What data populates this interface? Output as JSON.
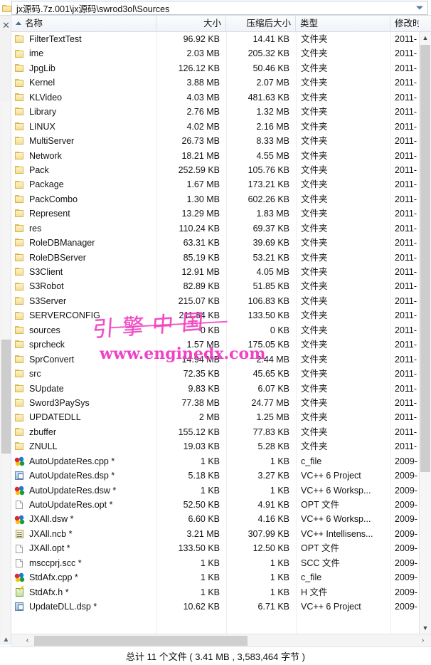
{
  "address": {
    "path": "jx源码.7z.001\\jx源码\\swrod3ol\\Sources",
    "dropdown_icon": "chevron-down-icon",
    "folder_icon": "folder-icon"
  },
  "left_rail": {
    "close_label": "✕",
    "up_label": "▲"
  },
  "columns": [
    {
      "key": "name",
      "label": "名称",
      "sorted": true
    },
    {
      "key": "size",
      "label": "大小",
      "sorted": false
    },
    {
      "key": "psize",
      "label": "压缩后大小",
      "sorted": false
    },
    {
      "key": "type",
      "label": "类型",
      "sorted": false
    },
    {
      "key": "mod",
      "label": "修改时",
      "sorted": false
    }
  ],
  "rows": [
    {
      "icon": "folder",
      "name": "FilterTextTest",
      "size": "96.92 KB",
      "psize": "14.41 KB",
      "type": "文件夹",
      "mod": "2011-"
    },
    {
      "icon": "folder",
      "name": "ime",
      "size": "2.03 MB",
      "psize": "205.32 KB",
      "type": "文件夹",
      "mod": "2011-"
    },
    {
      "icon": "folder",
      "name": "JpgLib",
      "size": "126.12 KB",
      "psize": "50.46 KB",
      "type": "文件夹",
      "mod": "2011-"
    },
    {
      "icon": "folder",
      "name": "Kernel",
      "size": "3.88 MB",
      "psize": "2.07 MB",
      "type": "文件夹",
      "mod": "2011-"
    },
    {
      "icon": "folder",
      "name": "KLVideo",
      "size": "4.03 MB",
      "psize": "481.63 KB",
      "type": "文件夹",
      "mod": "2011-"
    },
    {
      "icon": "folder",
      "name": "Library",
      "size": "2.76 MB",
      "psize": "1.32 MB",
      "type": "文件夹",
      "mod": "2011-"
    },
    {
      "icon": "folder",
      "name": "LINUX",
      "size": "4.02 MB",
      "psize": "2.16 MB",
      "type": "文件夹",
      "mod": "2011-"
    },
    {
      "icon": "folder",
      "name": "MultiServer",
      "size": "26.73 MB",
      "psize": "8.33 MB",
      "type": "文件夹",
      "mod": "2011-"
    },
    {
      "icon": "folder",
      "name": "Network",
      "size": "18.21 MB",
      "psize": "4.55 MB",
      "type": "文件夹",
      "mod": "2011-"
    },
    {
      "icon": "folder",
      "name": "Pack",
      "size": "252.59 KB",
      "psize": "105.76 KB",
      "type": "文件夹",
      "mod": "2011-"
    },
    {
      "icon": "folder",
      "name": "Package",
      "size": "1.67 MB",
      "psize": "173.21 KB",
      "type": "文件夹",
      "mod": "2011-"
    },
    {
      "icon": "folder",
      "name": "PackCombo",
      "size": "1.30 MB",
      "psize": "602.26 KB",
      "type": "文件夹",
      "mod": "2011-"
    },
    {
      "icon": "folder",
      "name": "Represent",
      "size": "13.29 MB",
      "psize": "1.83 MB",
      "type": "文件夹",
      "mod": "2011-"
    },
    {
      "icon": "folder",
      "name": "res",
      "size": "110.24 KB",
      "psize": "69.37 KB",
      "type": "文件夹",
      "mod": "2011-"
    },
    {
      "icon": "folder",
      "name": "RoleDBManager",
      "size": "63.31 KB",
      "psize": "39.69 KB",
      "type": "文件夹",
      "mod": "2011-"
    },
    {
      "icon": "folder",
      "name": "RoleDBServer",
      "size": "85.19 KB",
      "psize": "53.21 KB",
      "type": "文件夹",
      "mod": "2011-"
    },
    {
      "icon": "folder",
      "name": "S3Client",
      "size": "12.91 MB",
      "psize": "4.05 MB",
      "type": "文件夹",
      "mod": "2011-"
    },
    {
      "icon": "folder",
      "name": "S3Robot",
      "size": "82.89 KB",
      "psize": "51.85 KB",
      "type": "文件夹",
      "mod": "2011-"
    },
    {
      "icon": "folder",
      "name": "S3Server",
      "size": "215.07 KB",
      "psize": "106.83 KB",
      "type": "文件夹",
      "mod": "2011-"
    },
    {
      "icon": "folder",
      "name": "SERVERCONFIG",
      "size": "211.84 KB",
      "psize": "133.50 KB",
      "type": "文件夹",
      "mod": "2011-"
    },
    {
      "icon": "folder",
      "name": "sources",
      "size": "0 KB",
      "psize": "0 KB",
      "type": "文件夹",
      "mod": "2011-"
    },
    {
      "icon": "folder",
      "name": "sprcheck",
      "size": "1.57 MB",
      "psize": "175.05 KB",
      "type": "文件夹",
      "mod": "2011-"
    },
    {
      "icon": "folder",
      "name": "SprConvert",
      "size": "14.94 MB",
      "psize": "2.44 MB",
      "type": "文件夹",
      "mod": "2011-"
    },
    {
      "icon": "folder",
      "name": "src",
      "size": "72.35 KB",
      "psize": "45.65 KB",
      "type": "文件夹",
      "mod": "2011-"
    },
    {
      "icon": "folder",
      "name": "SUpdate",
      "size": "9.83 KB",
      "psize": "6.07 KB",
      "type": "文件夹",
      "mod": "2011-"
    },
    {
      "icon": "folder",
      "name": "Sword3PaySys",
      "size": "77.38 MB",
      "psize": "24.77 MB",
      "type": "文件夹",
      "mod": "2011-"
    },
    {
      "icon": "folder",
      "name": "UPDATEDLL",
      "size": "2 MB",
      "psize": "1.25 MB",
      "type": "文件夹",
      "mod": "2011-"
    },
    {
      "icon": "folder",
      "name": "zbuffer",
      "size": "155.12 KB",
      "psize": "77.83 KB",
      "type": "文件夹",
      "mod": "2011-"
    },
    {
      "icon": "folder",
      "name": "ZNULL",
      "size": "19.03 KB",
      "psize": "5.28 KB",
      "type": "文件夹",
      "mod": "2011-"
    },
    {
      "icon": "vcblob",
      "name": "AutoUpdateRes.cpp *",
      "size": "1 KB",
      "psize": "1 KB",
      "type": "c_file",
      "mod": "2009-"
    },
    {
      "icon": "dsp",
      "name": "AutoUpdateRes.dsp *",
      "size": "5.18 KB",
      "psize": "3.27 KB",
      "type": "VC++ 6 Project",
      "mod": "2009-"
    },
    {
      "icon": "vcblob",
      "name": "AutoUpdateRes.dsw *",
      "size": "1 KB",
      "psize": "1 KB",
      "type": "VC++ 6 Worksp...",
      "mod": "2009-"
    },
    {
      "icon": "doc",
      "name": "AutoUpdateRes.opt *",
      "size": "52.50 KB",
      "psize": "4.91 KB",
      "type": "OPT 文件",
      "mod": "2009-"
    },
    {
      "icon": "vcblob",
      "name": "JXAll.dsw *",
      "size": "6.60 KB",
      "psize": "4.16 KB",
      "type": "VC++ 6 Worksp...",
      "mod": "2009-"
    },
    {
      "icon": "ncb",
      "name": "JXAll.ncb *",
      "size": "3.21 MB",
      "psize": "307.99 KB",
      "type": "VC++ Intellisens...",
      "mod": "2009-"
    },
    {
      "icon": "doc",
      "name": "JXAll.opt *",
      "size": "133.50 KB",
      "psize": "12.50 KB",
      "type": "OPT 文件",
      "mod": "2009-"
    },
    {
      "icon": "doc",
      "name": "msccprj.scc *",
      "size": "1 KB",
      "psize": "1 KB",
      "type": "SCC 文件",
      "mod": "2009-"
    },
    {
      "icon": "vcblob",
      "name": "StdAfx.cpp *",
      "size": "1 KB",
      "psize": "1 KB",
      "type": "c_file",
      "mod": "2009-"
    },
    {
      "icon": "hfile",
      "name": "StdAfx.h *",
      "size": "1 KB",
      "psize": "1 KB",
      "type": "H 文件",
      "mod": "2009-"
    },
    {
      "icon": "dsp",
      "name": "UpdateDLL.dsp *",
      "size": "10.62 KB",
      "psize": "6.71 KB",
      "type": "VC++ 6 Project",
      "mod": "2009-"
    }
  ],
  "scrollbars": {
    "v_up": "▲",
    "v_down": "▼",
    "h_left": "‹",
    "h_right": "›"
  },
  "statusbar": {
    "text": "总计 11 个文件 ( 3.41 MB , 3,583,464 字节 )"
  },
  "watermark": {
    "script_text": "引擎中国",
    "url_text": "www.enginedx.com",
    "color": "#f038c4"
  }
}
